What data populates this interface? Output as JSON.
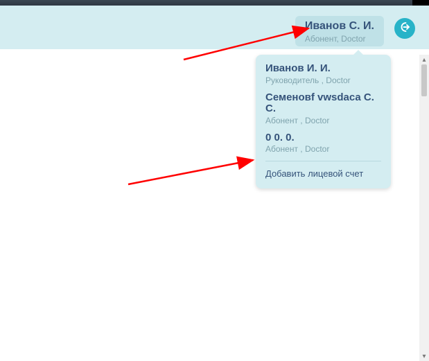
{
  "header": {
    "user_name": "Иванов С. И.",
    "user_role": "Абонент, Doctor"
  },
  "accounts": [
    {
      "name": "Иванов И. И.",
      "role": "Руководитель , Doctor"
    },
    {
      "name": "Семеновf vwsdаса С. С.",
      "role": "Абонент , Doctor"
    },
    {
      "name": "0 0. 0.",
      "role": "Абонент , Doctor"
    }
  ],
  "add_account_link": "Добавить лицевой счет",
  "colors": {
    "accent": "#28b3c8",
    "panel": "#d4edf1",
    "chip": "#bfe1e7",
    "text": "#35537a",
    "muted": "#7fa3ad",
    "arrow": "#ff0000"
  }
}
